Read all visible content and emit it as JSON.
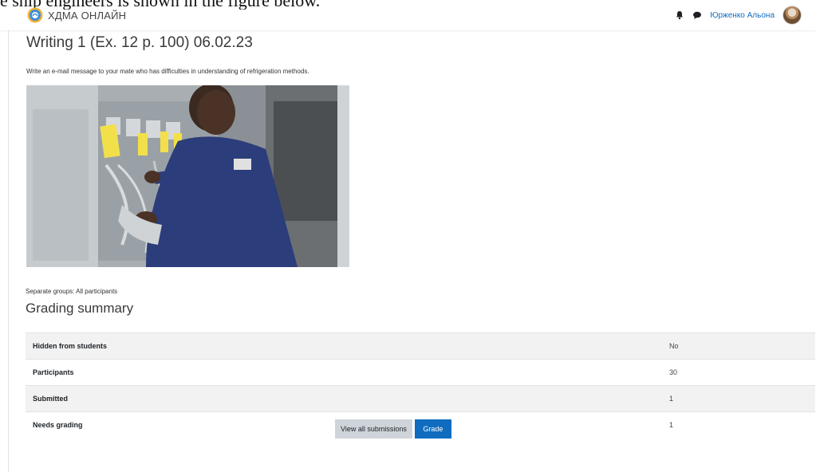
{
  "document_fragment": "e ship engineers is shown in the figure below.",
  "navbar": {
    "site_name": "ХДМА ОНЛАЙН",
    "bell_icon": "bell-icon",
    "messages_icon": "chat-bubble-icon",
    "user_name": "Юрженко Альона"
  },
  "assignment": {
    "title": "Writing 1 (Ex. 12 p. 100) 06.02.23",
    "intro": "Write an e-mail message to your mate who has difficulties in understanding of refrigeration methods.",
    "image_description_icon": "photo"
  },
  "groups_label": "Separate groups: All participants",
  "grading_summary": {
    "title": "Grading summary",
    "rows": [
      {
        "label": "Hidden from students",
        "value": "No"
      },
      {
        "label": "Participants",
        "value": "30"
      },
      {
        "label": "Submitted",
        "value": "1"
      },
      {
        "label": "Needs grading",
        "value": "1"
      }
    ]
  },
  "actions": {
    "view_all": "View all submissions",
    "grade": "Grade"
  },
  "colors": {
    "primary": "#0f6cbf",
    "secondary": "#ced4da",
    "row_stripe": "#f2f2f2"
  }
}
